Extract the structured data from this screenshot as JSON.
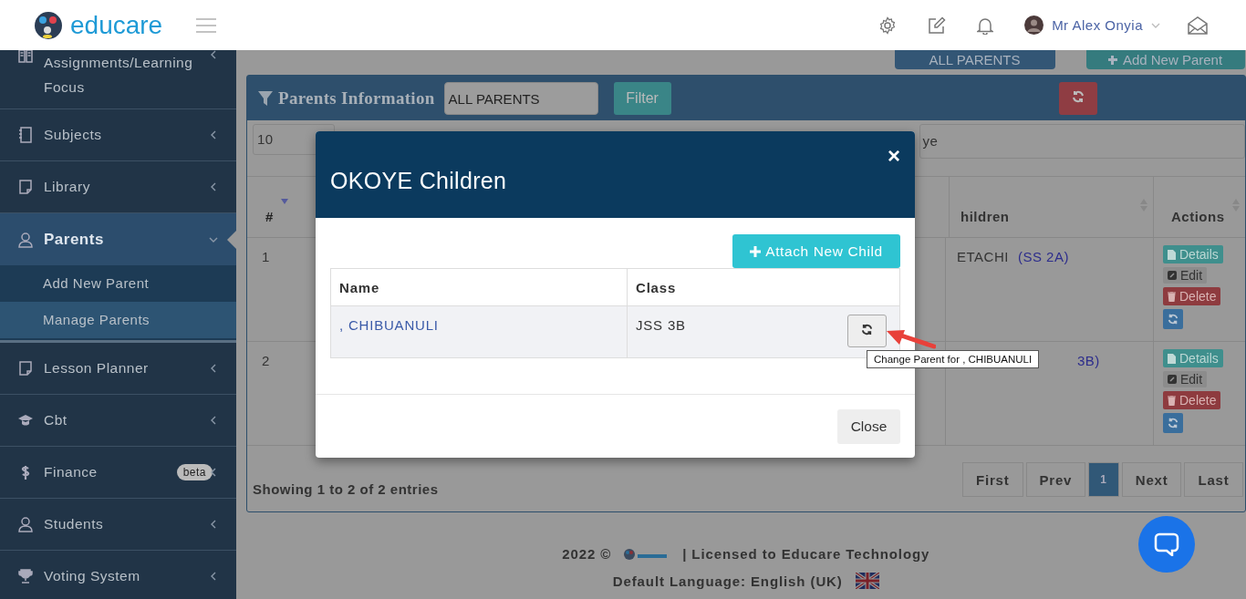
{
  "header": {
    "brand": "educare",
    "user": "Mr Alex Onyia"
  },
  "sidebar": {
    "items": [
      {
        "label": "Assignments/Learning Focus",
        "selected": false,
        "expanded": false
      },
      {
        "label": "Subjects",
        "selected": false,
        "expanded": false
      },
      {
        "label": "Library",
        "selected": false,
        "expanded": false
      },
      {
        "label": "Parents",
        "selected": true,
        "expanded": true,
        "children": [
          {
            "label": "Add New Parent",
            "selected": false
          },
          {
            "label": "Manage Parents",
            "selected": true
          }
        ]
      },
      {
        "label": "Lesson Planner",
        "selected": false,
        "expanded": false
      },
      {
        "label": "Cbt",
        "selected": false,
        "expanded": false
      },
      {
        "label": "Finance",
        "selected": false,
        "expanded": false,
        "badge": "beta"
      },
      {
        "label": "Students",
        "selected": false,
        "expanded": false
      },
      {
        "label": "Voting System",
        "selected": false,
        "expanded": false
      }
    ]
  },
  "top_buttons": [
    {
      "label": "ALL PARENTS",
      "kind": "primary"
    },
    {
      "label": "Add New Parent",
      "kind": "add"
    }
  ],
  "panel": {
    "title": "Parents Information",
    "filter_select": "ALL PARENTS",
    "filter_button": "Filter",
    "page_length": "10",
    "search": "ye",
    "columns": [
      {
        "label": "#",
        "sorted": true
      },
      {
        "label": "hildren",
        "sorted": false
      },
      {
        "label": "Actions",
        "sorted": false
      }
    ],
    "rows": [
      {
        "number": "1",
        "child_name": "ETACHI",
        "child_class": "(SS 2A)",
        "actions": [
          {
            "label": "Details",
            "kind": "details"
          },
          {
            "label": "Edit",
            "kind": "edit"
          },
          {
            "label": "Delete",
            "kind": "delete"
          },
          {
            "kind": "refresh"
          }
        ]
      },
      {
        "number": "2",
        "child_class": "3B)",
        "actions": [
          {
            "label": "Details",
            "kind": "details"
          },
          {
            "label": "Edit",
            "kind": "edit"
          },
          {
            "label": "Delete",
            "kind": "delete"
          },
          {
            "kind": "refresh"
          }
        ]
      }
    ],
    "info": "Showing 1 to 2 of 2 entries",
    "pagination": [
      {
        "label": "First",
        "selected": false
      },
      {
        "label": "Prev",
        "selected": false
      },
      {
        "label": "1",
        "selected": true
      },
      {
        "label": "Next",
        "selected": false
      },
      {
        "label": "Last",
        "selected": false
      }
    ]
  },
  "footer": {
    "year": "2022 ©",
    "license": "|  Licensed to Educare Technology",
    "language": "Default Language: English (UK)"
  },
  "modal": {
    "title": "OKOYE Children",
    "close": "×",
    "attach_button": "Attach New Child",
    "columns": [
      "Name",
      "Class"
    ],
    "rows": [
      {
        "name": ", CHIBUANULI",
        "class": "JSS 3B"
      }
    ],
    "tooltip": "Change Parent for , CHIBUANULI",
    "close_button": "Close"
  }
}
